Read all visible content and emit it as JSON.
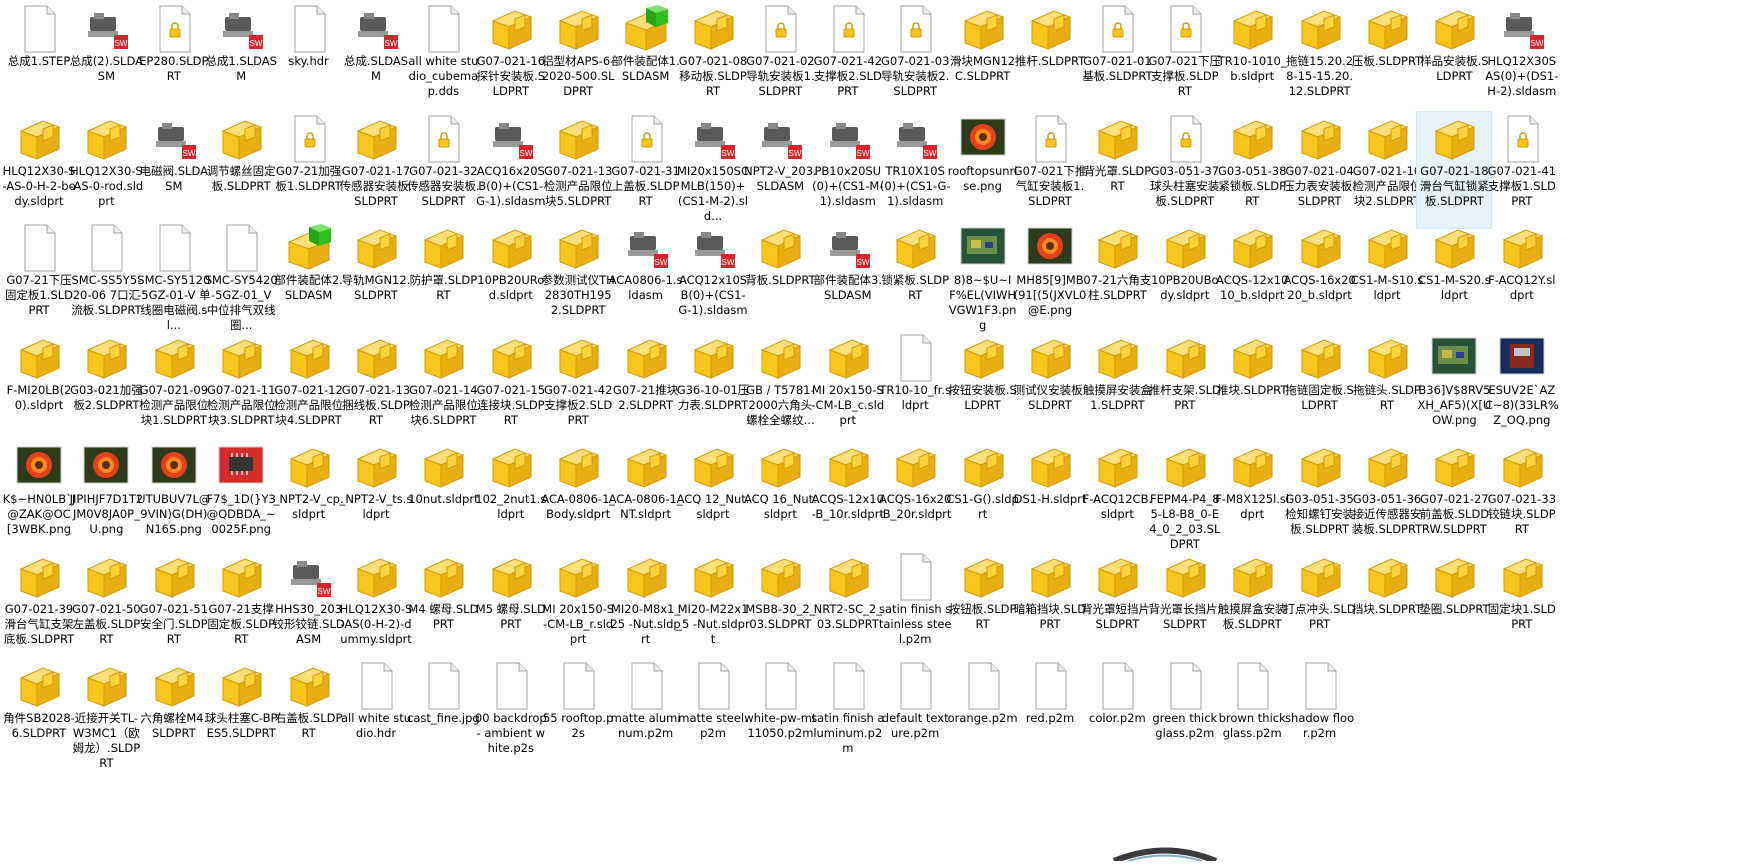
{
  "explorer": {
    "view": "large-icons",
    "selected_index": 44,
    "colors": {
      "folder_yellow": "#f7c51b",
      "folder_dark": "#d39a06",
      "sw_red": "#d8242a",
      "green": "#2ec01e",
      "select_bg": "#e5f1fb"
    },
    "files": [
      {
        "name": "总成1.STEP",
        "icon": "blank-doc-icon"
      },
      {
        "name": "总成(2).SLDASM",
        "icon": "assembly-icon"
      },
      {
        "name": "EP280.SLDPRT",
        "icon": "locked-doc-icon"
      },
      {
        "name": "总成1.SLDASM",
        "icon": "assembly-icon"
      },
      {
        "name": "sky.hdr",
        "icon": "blank-doc-icon"
      },
      {
        "name": "总成.SLDASM",
        "icon": "assembly-icon"
      },
      {
        "name": "all white studio_cubemap.dds",
        "icon": "blank-doc-icon"
      },
      {
        "name": "G07-021-16探针安装板.SLDPRT",
        "icon": "part-icon"
      },
      {
        "name": "铝型材APS-6-2020-500.SLDPRT",
        "icon": "part-icon"
      },
      {
        "name": "部件装配体1.SLDASM",
        "icon": "green-part-icon"
      },
      {
        "name": "G07-021-08移动板.SLDPRT",
        "icon": "part-icon"
      },
      {
        "name": "G07-021-02导轨安装板1.SLDPRT",
        "icon": "locked-doc-icon"
      },
      {
        "name": "G07-021-42支撑板2.SLDPRT",
        "icon": "locked-doc-icon"
      },
      {
        "name": "G07-021-03 导轨安装板2.SLDPRT",
        "icon": "locked-doc-icon"
      },
      {
        "name": "滑块MGN12C.SLDPRT",
        "icon": "part-icon"
      },
      {
        "name": "推杆.SLDPRT",
        "icon": "part-icon"
      },
      {
        "name": "G07-021-01基板.SLDPRT",
        "icon": "locked-doc-icon"
      },
      {
        "name": "G07-021下压支撑板.SLDPRT",
        "icon": "locked-doc-icon"
      },
      {
        "name": "TR10-1010_b.sldprt",
        "icon": "part-icon"
      },
      {
        "name": "拖链15.20.28-15-15.20.12.SLDPRT",
        "icon": "part-icon"
      },
      {
        "name": "压板.SLDPRT",
        "icon": "part-icon"
      },
      {
        "name": "样品安装板.SLDPRT",
        "icon": "part-icon"
      },
      {
        "name": "HLQ12X30SAS(0)+(DS1-H-2).sldasm",
        "icon": "assembly-icon"
      },
      {
        "name": "HLQ12X30-S-AS-0-H-2-body.sldprt",
        "icon": "part-icon"
      },
      {
        "name": "HLQ12X30-S-AS-0-rod.sldprt",
        "icon": "part-icon"
      },
      {
        "name": "电磁阀.SLDASM",
        "icon": "assembly-icon"
      },
      {
        "name": "调节螺丝固定板.SLDPRT",
        "icon": "part-icon"
      },
      {
        "name": "G07-21加强板1.SLDPRT",
        "icon": "locked-doc-icon"
      },
      {
        "name": "G07-021-17传感器安装板.SLDPRT",
        "icon": "part-icon"
      },
      {
        "name": "G07-021-32传感器安装板.SLDPRT",
        "icon": "locked-doc-icon"
      },
      {
        "name": "ACQ16x20SB(0)+(CS1-G-1).sldasm",
        "icon": "assembly-icon"
      },
      {
        "name": "G07-021-13检测产品限位块5.SLDPRT",
        "icon": "part-icon"
      },
      {
        "name": "G07-021-31上盖板.SLDPRT",
        "icon": "locked-doc-icon"
      },
      {
        "name": "MI20x150SCMLB(150)+(CS1-M-2).sld...",
        "icon": "assembly-icon"
      },
      {
        "name": "NPT2-V_203.SLDASM",
        "icon": "assembly-icon"
      },
      {
        "name": "PB10x20SU(0)+(CS1-M-1).sldasm",
        "icon": "assembly-icon"
      },
      {
        "name": "TR10X10S(0)+(CS1-G-1).sldasm",
        "icon": "assembly-icon"
      },
      {
        "name": "rooftopsunrise.png",
        "icon": "flower-image-icon"
      },
      {
        "name": "G07-021下推气缸安装板1.SLDPRT",
        "icon": "locked-doc-icon"
      },
      {
        "name": "背光罩.SLDPRT",
        "icon": "part-icon"
      },
      {
        "name": "G03-051-37 球头柱塞安装板.SLDPRT",
        "icon": "locked-doc-icon"
      },
      {
        "name": "G03-051-38紧锁板.SLDPRT",
        "icon": "part-icon"
      },
      {
        "name": "G07-021-04压力表安装板.SLDPRT",
        "icon": "part-icon"
      },
      {
        "name": "G07-021-10 检测产品限位块2.SLDPRT",
        "icon": "part-icon"
      },
      {
        "name": "G07-021-18滑台气缸锁紧板.SLDPRT",
        "icon": "part-icon"
      },
      {
        "name": "G07-021-41支撑板1.SLDPRT",
        "icon": "locked-doc-icon"
      },
      {
        "name": "G07-21下压固定板1.SLDPRT",
        "icon": "blank-doc-icon"
      },
      {
        "name": "SMC-SS5Y5-20-06 7口汇流板.SLDPRT",
        "icon": "blank-doc-icon"
      },
      {
        "name": "SMC-SY5120-5GZ-01-V 单线圈电磁阀.sl...",
        "icon": "blank-doc-icon"
      },
      {
        "name": "SMC-SY5420-5GZ-01_V 中位排气双线圈...",
        "icon": "blank-doc-icon"
      },
      {
        "name": "部件装配体2.SLDASM",
        "icon": "green-part-icon"
      },
      {
        "name": "导轨MGN12.SLDPRT",
        "icon": "part-icon"
      },
      {
        "name": "防护罩.SLDPRT",
        "icon": "part-icon"
      },
      {
        "name": "10PB20URod.sldprt",
        "icon": "part-icon"
      },
      {
        "name": "参数测试仪TH2830TH1952.SLDPRT",
        "icon": "part-icon"
      },
      {
        "name": "ACA0806-1.sldasm",
        "icon": "assembly-icon"
      },
      {
        "name": "ACQ12x10SB(0)+(CS1-G-1).sldasm",
        "icon": "assembly-icon"
      },
      {
        "name": "背板.SLDPRT",
        "icon": "part-icon"
      },
      {
        "name": "部件装配体3.SLDASM",
        "icon": "assembly-icon"
      },
      {
        "name": "锁紧板.SLDPRT",
        "icon": "part-icon"
      },
      {
        "name": "8)8~$U~IF%EL(VIWHVGW1F3.png",
        "icon": "photo-image-icon"
      },
      {
        "name": "MH85[9]MB(91[(5(JXVL0@E.png",
        "icon": "flower-image-icon"
      },
      {
        "name": "07-21六角支柱.SLDPRT",
        "icon": "part-icon"
      },
      {
        "name": "10PB20UBody.sldprt",
        "icon": "part-icon"
      },
      {
        "name": "ACQS-12x1010_b.sldprt",
        "icon": "part-icon"
      },
      {
        "name": "ACQS-16x2020_b.sldprt",
        "icon": "part-icon"
      },
      {
        "name": "CS1-M-S10.sldprt",
        "icon": "part-icon"
      },
      {
        "name": "CS1-M-S20.sldprt",
        "icon": "part-icon"
      },
      {
        "name": "F-ACQ12Y.sldprt",
        "icon": "part-icon"
      },
      {
        "name": "F-MI20LB(20).sldprt",
        "icon": "part-icon"
      },
      {
        "name": "G03-021加强板2.SLDPRT",
        "icon": "part-icon"
      },
      {
        "name": "G07-021-09 检测产品限位块1.SLDPRT",
        "icon": "part-icon"
      },
      {
        "name": "G07-021-11检测产品限位块3.SLDPRT",
        "icon": "part-icon"
      },
      {
        "name": "G07-021-12 检测产品限位块4.SLDPRT",
        "icon": "part-icon"
      },
      {
        "name": "G07-021-13捆线板.SLDPRT",
        "icon": "part-icon"
      },
      {
        "name": "G07-021-14检测产品限位块6.SLDPRT",
        "icon": "part-icon"
      },
      {
        "name": "G07-021-15连接块.SLDPRT",
        "icon": "part-icon"
      },
      {
        "name": "G07-021-42 支撑板2.SLDPRT",
        "icon": "part-icon"
      },
      {
        "name": "G07-21推块2.SLDPRT",
        "icon": "part-icon"
      },
      {
        "name": "G36-10-01压力表.SLDPRT",
        "icon": "part-icon"
      },
      {
        "name": "GB / T5781-2000六角头螺栓全螺纹...",
        "icon": "part-icon"
      },
      {
        "name": "MI 20x150-S-CM-LB_c.sldprt",
        "icon": "part-icon"
      },
      {
        "name": "TR10-10_fr.sldprt",
        "icon": "blank-doc-icon"
      },
      {
        "name": "按钮安装板.SLDPRT",
        "icon": "part-icon"
      },
      {
        "name": "测试仪安装板.SLDPRT",
        "icon": "part-icon"
      },
      {
        "name": "触摸屏安装盒1.SLDPRT",
        "icon": "part-icon"
      },
      {
        "name": "推杆支架.SLDPRT",
        "icon": "part-icon"
      },
      {
        "name": "推块.SLDPRT",
        "icon": "part-icon"
      },
      {
        "name": "拖链固定板.SLDPRT",
        "icon": "part-icon"
      },
      {
        "name": "拖链头.SLDPRT",
        "icon": "part-icon"
      },
      {
        "name": "B36]V$8RV5XH_AF5)(X[UOW.png",
        "icon": "photo-image-icon"
      },
      {
        "name": "ESUV2E`AZC~8)(33LR%Z_OQ.png",
        "icon": "machine-image-icon"
      },
      {
        "name": "K$~HN0LB`J@ZAK@OC[3WBK.png",
        "icon": "flower-image-icon"
      },
      {
        "name": "JIPIHJF7D1T2JM0V8JA0P_U.png",
        "icon": "flower-image-icon"
      },
      {
        "name": "UTUBUV7L@9VIN)G(DH)N16S.png",
        "icon": "flower-image-icon"
      },
      {
        "name": "F7$_1D(}Y3@QDBDA_~0025F.png",
        "icon": "chip-image-icon"
      },
      {
        "name": "_NPT2-V_cp.sldprt",
        "icon": "part-icon"
      },
      {
        "name": "_NPT2-V_ts.sldprt",
        "icon": "part-icon"
      },
      {
        "name": "10nut.sldprt",
        "icon": "part-icon"
      },
      {
        "name": "102_2nut1.sldprt",
        "icon": "part-icon"
      },
      {
        "name": "ACA-0806-1_Body.sldprt",
        "icon": "part-icon"
      },
      {
        "name": "ACA-0806-1_NT.sldprt",
        "icon": "part-icon"
      },
      {
        "name": "ACQ 12_Nut.sldprt",
        "icon": "part-icon"
      },
      {
        "name": "ACQ 16_Nut.sldprt",
        "icon": "part-icon"
      },
      {
        "name": "ACQS-12x10-B_10r.sldprt",
        "icon": "part-icon"
      },
      {
        "name": "ACQS-16x20-B_20r.sldprt",
        "icon": "part-icon"
      },
      {
        "name": "CS1-G().sldprt",
        "icon": "part-icon"
      },
      {
        "name": "DS1-H.sldprt",
        "icon": "part-icon"
      },
      {
        "name": "F-ACQ12CB.sldprt",
        "icon": "part-icon"
      },
      {
        "name": "FEPM4-P4_85-L8-B8_0-E4_0_2_03.SLDPRT",
        "icon": "part-icon"
      },
      {
        "name": "F-M8X125l.sldprt",
        "icon": "part-icon"
      },
      {
        "name": "G03-051-35检知螺钉安装板.SLDPRT",
        "icon": "part-icon"
      },
      {
        "name": "G03-051-36接近传感器安装板.SLDPRT",
        "icon": "part-icon"
      },
      {
        "name": "G07-021-27前盖板.SLDDRW.SLDPRT",
        "icon": "part-icon"
      },
      {
        "name": "G07-021-33铰链块.SLDPRT",
        "icon": "part-icon"
      },
      {
        "name": "G07-021-39滑台气缸支架底板.SLDPRT",
        "icon": "part-icon"
      },
      {
        "name": "G07-021-50 左盖板.SLDPRT",
        "icon": "part-icon"
      },
      {
        "name": "G07-021-51安全门.SLDPRT",
        "icon": "part-icon"
      },
      {
        "name": "G07-21支撑固定板.SLDPRT",
        "icon": "part-icon"
      },
      {
        "name": "HHS30_203铰形铰链.SLDASM",
        "icon": "assembly-icon"
      },
      {
        "name": "HLQ12X30-S-AS(0-H-2)-dummy.sldprt",
        "icon": "part-icon"
      },
      {
        "name": "M4 螺母.SLDPRT",
        "icon": "part-icon"
      },
      {
        "name": "M5 螺母.SLDPRT",
        "icon": "part-icon"
      },
      {
        "name": "MI 20x150-S-CM-LB_r.sldprt",
        "icon": "part-icon"
      },
      {
        "name": "MI20-M8x1_25 -Nut.sldprt",
        "icon": "part-icon"
      },
      {
        "name": "MI20-M22x1_5 -Nut.sldprt",
        "icon": "part-icon"
      },
      {
        "name": "MSB8-30_2_03.SLDPRT",
        "icon": "part-icon"
      },
      {
        "name": "NRT2-SC_2_03.SLDPRT",
        "icon": "part-icon"
      },
      {
        "name": "satin finish stainless steel.p2m",
        "icon": "blank-doc-icon"
      },
      {
        "name": "按钮板.SLDPRT",
        "icon": "part-icon"
      },
      {
        "name": "暗箱挡块.SLDPRT",
        "icon": "part-icon"
      },
      {
        "name": "背光罩短挡片.SLDPRT",
        "icon": "part-icon"
      },
      {
        "name": "背光罩长挡片.SLDPRT",
        "icon": "part-icon"
      },
      {
        "name": "触摸屏盒安装板.SLDPRT",
        "icon": "part-icon"
      },
      {
        "name": "打点冲头.SLDPRT",
        "icon": "part-icon"
      },
      {
        "name": "挡块.SLDPRT",
        "icon": "part-icon"
      },
      {
        "name": "垫圈.SLDPRT",
        "icon": "part-icon"
      },
      {
        "name": "固定块1.SLDPRT",
        "icon": "part-icon"
      },
      {
        "name": "角件SB2028-6.SLDPRT",
        "icon": "part-icon"
      },
      {
        "name": "近接开关TL-W3MC1（欧姆龙）.SLDPRT",
        "icon": "part-icon"
      },
      {
        "name": "六角螺栓M4.SLDPRT",
        "icon": "part-icon"
      },
      {
        "name": "球头柱塞C-BPES5.SLDPRT",
        "icon": "part-icon"
      },
      {
        "name": "右盖板.SLDPRT",
        "icon": "part-icon"
      },
      {
        "name": "all white studio.hdr",
        "icon": "blank-doc-icon"
      },
      {
        "name": "cast_fine.jpg",
        "icon": "blank-doc-icon"
      },
      {
        "name": "00 backdrop - ambient white.p2s",
        "icon": "blank-doc-icon"
      },
      {
        "name": "55 rooftop.p2s",
        "icon": "blank-doc-icon"
      },
      {
        "name": "matte aluminum.p2m",
        "icon": "blank-doc-icon"
      },
      {
        "name": "matte steel.p2m",
        "icon": "blank-doc-icon"
      },
      {
        "name": "white-pw-mt11050.p2m",
        "icon": "blank-doc-icon"
      },
      {
        "name": "satin finish aluminum.p2m",
        "icon": "blank-doc-icon"
      },
      {
        "name": "default texture.p2m",
        "icon": "blank-doc-icon"
      },
      {
        "name": "orange.p2m",
        "icon": "blank-doc-icon"
      },
      {
        "name": "red.p2m",
        "icon": "blank-doc-icon"
      },
      {
        "name": "color.p2m",
        "icon": "blank-doc-icon"
      },
      {
        "name": "green thick glass.p2m",
        "icon": "blank-doc-icon"
      },
      {
        "name": "brown thick glass.p2m",
        "icon": "blank-doc-icon"
      },
      {
        "name": "shadow floor.p2m",
        "icon": "blank-doc-icon"
      }
    ]
  }
}
